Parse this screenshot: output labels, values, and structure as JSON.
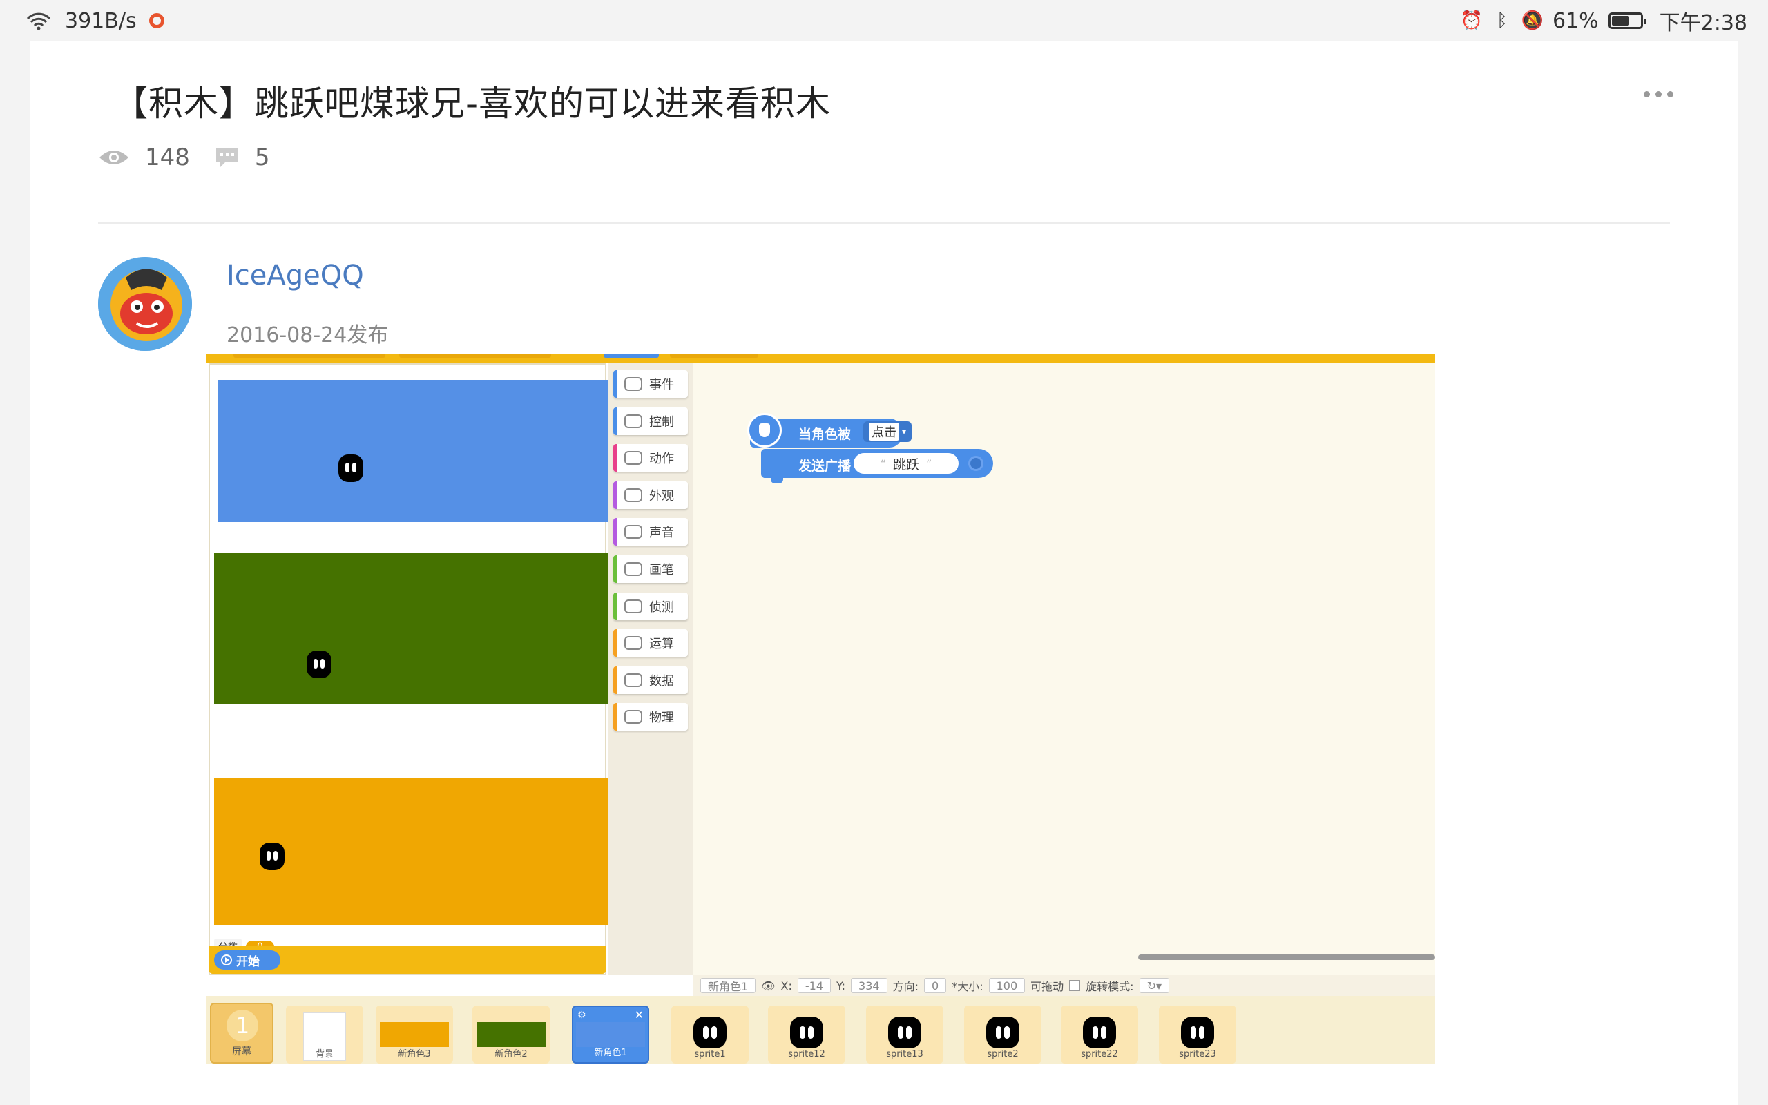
{
  "status": {
    "net_speed": "391B/s",
    "battery_pct": "61%",
    "time": "下午2:38",
    "icons": [
      "wifi-icon",
      "recording-icon",
      "alarm-icon",
      "bluetooth-icon",
      "mute-icon",
      "battery-icon"
    ]
  },
  "post": {
    "title": "【积木】跳跃吧煤球兄-喜欢的可以进来看积木",
    "views": "148",
    "comments": "5",
    "author": "IceAgeQQ",
    "date": "2016-08-24发布"
  },
  "editor": {
    "score_label": "分数",
    "score_value": "0",
    "start_label": "开始",
    "categories": [
      {
        "label": "事件",
        "color": "#4a8ee8",
        "icon": "toggle-icon"
      },
      {
        "label": "控制",
        "color": "#4a8ee8",
        "icon": "gamepad-icon"
      },
      {
        "label": "动作",
        "color": "#e8408a",
        "icon": "run-icon"
      },
      {
        "label": "外观",
        "color": "#b45be0",
        "icon": "shirt-icon"
      },
      {
        "label": "声音",
        "color": "#b45be0",
        "icon": "speaker-icon"
      },
      {
        "label": "画笔",
        "color": "#6bbf3a",
        "icon": "pen-icon"
      },
      {
        "label": "侦测",
        "color": "#6bbf3a",
        "icon": "sensor-icon"
      },
      {
        "label": "运算",
        "color": "#f5a020",
        "icon": "calculator-icon"
      },
      {
        "label": "数据",
        "color": "#f5a020",
        "icon": "chart-icon"
      },
      {
        "label": "物理",
        "color": "#f5a020",
        "icon": "magnet-icon"
      }
    ],
    "hat_block": {
      "label": "当角色被",
      "dropdown": "点击"
    },
    "command_block": {
      "label": "发送广播",
      "value": "跳跃"
    },
    "props": {
      "sprite_name": "新角色1",
      "x_label": "X:",
      "x": "-14",
      "y_label": "Y:",
      "y": "334",
      "dir_label": "方向:",
      "dir": "0",
      "size_label": "*大小:",
      "size": "100",
      "drag_label": "可拖动",
      "rot_label": "旋转模式:"
    },
    "tray": {
      "screen_num": "1",
      "screen_label": "屏幕",
      "tiles": [
        "背景",
        "新角色3",
        "新角色2",
        "新角色1",
        "sprite1",
        "sprite12",
        "sprite13",
        "sprite2",
        "sprite22",
        "sprite23"
      ]
    },
    "backgrounds": {
      "blue": "#5590e6",
      "green": "#457200",
      "orange": "#f0a702"
    }
  }
}
